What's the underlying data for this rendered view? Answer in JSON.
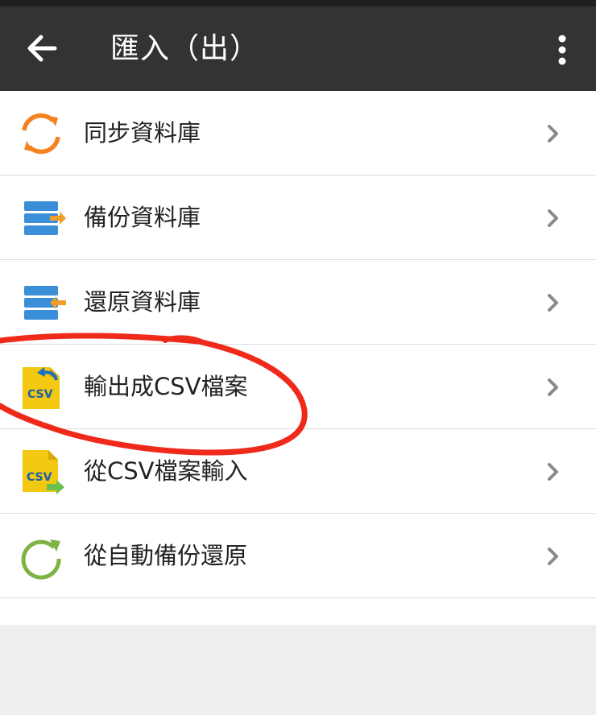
{
  "app_bar": {
    "title": "匯入（出）",
    "back_icon": "arrow-left-icon",
    "menu_icon": "more-vertical-icon"
  },
  "menu_items": [
    {
      "label": "同步資料庫",
      "icon": "sync-icon"
    },
    {
      "label": "備份資料庫",
      "icon": "database-backup-icon"
    },
    {
      "label": "還原資料庫",
      "icon": "database-restore-icon"
    },
    {
      "label": "輸出成CSV檔案",
      "icon": "csv-export-icon"
    },
    {
      "label": "從CSV檔案輸入",
      "icon": "csv-import-icon"
    },
    {
      "label": "從自動備份還原",
      "icon": "auto-backup-restore-icon"
    }
  ],
  "colors": {
    "app_bar": "#333333",
    "accent_orange": "#f5821f",
    "db_blue": "#3a8fd8",
    "csv_yellow": "#f2c811",
    "restore_green": "#7cb342",
    "annotation_red": "#f02a1a"
  }
}
